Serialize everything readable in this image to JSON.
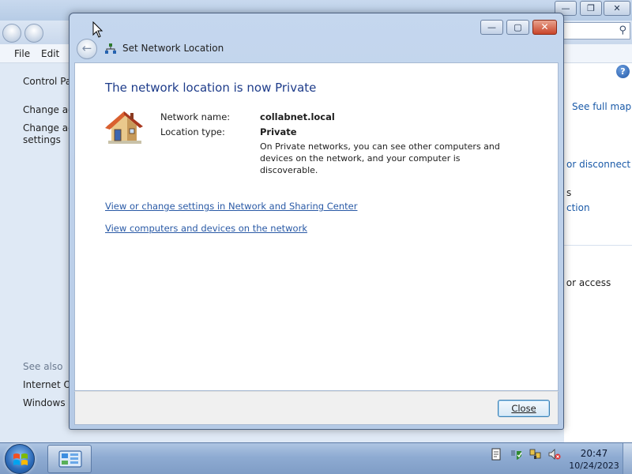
{
  "background_window": {
    "menu": {
      "file": "File",
      "edit": "Edit"
    },
    "left_panel": {
      "home": "Control Pa",
      "change_adapter": "Change ad",
      "change_advanced_line1": "Change ad",
      "change_advanced_line2": "settings",
      "see_also": "See also",
      "internet_options": "Internet Op",
      "windows_firewall": "Windows F"
    },
    "right_panel": {
      "help": "?",
      "see_full_map": "See full map",
      "connect_disconnect": "or disconnect",
      "item_s": "s",
      "item_ction": "ction",
      "item_access": "r or access"
    }
  },
  "dialog": {
    "title": "Set Network Location",
    "heading": "The network location is now Private",
    "network_name_label": "Network name:",
    "network_name_value": "collabnet.local",
    "location_type_label": "Location type:",
    "location_type_value": "Private",
    "description": "On Private networks, you can see other computers and devices on the network, and your computer is discoverable.",
    "link_settings": "View or change settings in Network and Sharing Center",
    "link_computers": "View computers and devices on the network",
    "close_button": "Close"
  },
  "taskbar": {
    "clock_time": "20:47",
    "clock_date": "10/24/2023"
  }
}
